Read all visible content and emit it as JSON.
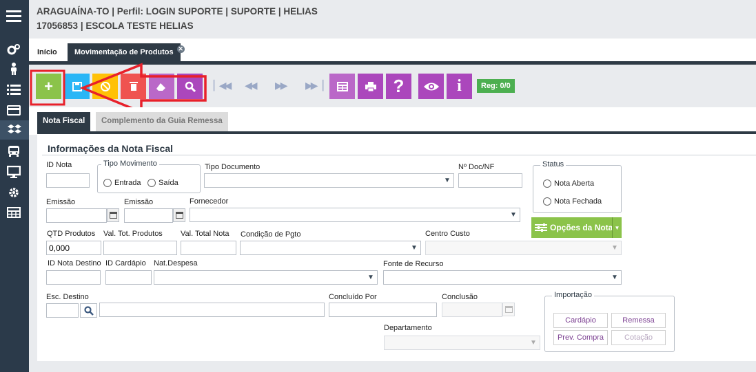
{
  "header": {
    "line1": "ARAGUAÍNA-TO | Perfil: LOGIN SUPORTE | SUPORTE | HELIAS",
    "line2": "17056853 | ESCOLA TESTE HELIAS"
  },
  "tabs": [
    {
      "label": "Início"
    },
    {
      "label": "Movimentação de Produtos"
    }
  ],
  "toolbar": {
    "reg": "Reg: 0/0",
    "colors": {
      "add": "#8bc34a",
      "save": "#29b6f6",
      "cancel": "#ffc107",
      "delete": "#ef5350",
      "clear": "#ba68c8",
      "search": "#ab47bc",
      "tool": "#ab47bc",
      "annotation": "#e8202a"
    }
  },
  "subtabs": [
    {
      "label": "Nota Fiscal"
    },
    {
      "label": "Complemento da Guia Remessa"
    }
  ],
  "form": {
    "title": "Informações da Nota Fiscal",
    "id_nota": "ID Nota",
    "tipo_movimento": "Tipo Movimento",
    "entrada": "Entrada",
    "saida": "Saída",
    "tipo_documento": "Tipo Documento",
    "no_doc": "Nº Doc/NF",
    "status": "Status",
    "nota_aberta": "Nota Aberta",
    "nota_fechada": "Nota Fechada",
    "emissao1": "Emissão",
    "emissao2": "Emissão",
    "fornecedor": "Fornecedor",
    "opcoes": "Opções da Nota",
    "qtd_produtos": "QTD Produtos",
    "qtd_value": "0,000",
    "val_tot_produtos": "Val. Tot. Produtos",
    "val_total_nota": "Val. Total Nota",
    "condicao": "Condição de Pgto",
    "centro_custo": "Centro Custo",
    "id_nota_destino": "ID Nota Destino",
    "id_cardapio": "ID Cardápio",
    "nat_despesa": "Nat.Despesa",
    "fonte_recurso": "Fonte de Recurso",
    "esc_destino": "Esc. Destino",
    "concluido_por": "Concluído Por",
    "conclusao": "Conclusão",
    "departamento": "Departamento",
    "importacao": "Importação",
    "cardapio": "Cardápio",
    "remessa": "Remessa",
    "prev_compra": "Prev. Compra",
    "cotacao": "Cotação"
  }
}
